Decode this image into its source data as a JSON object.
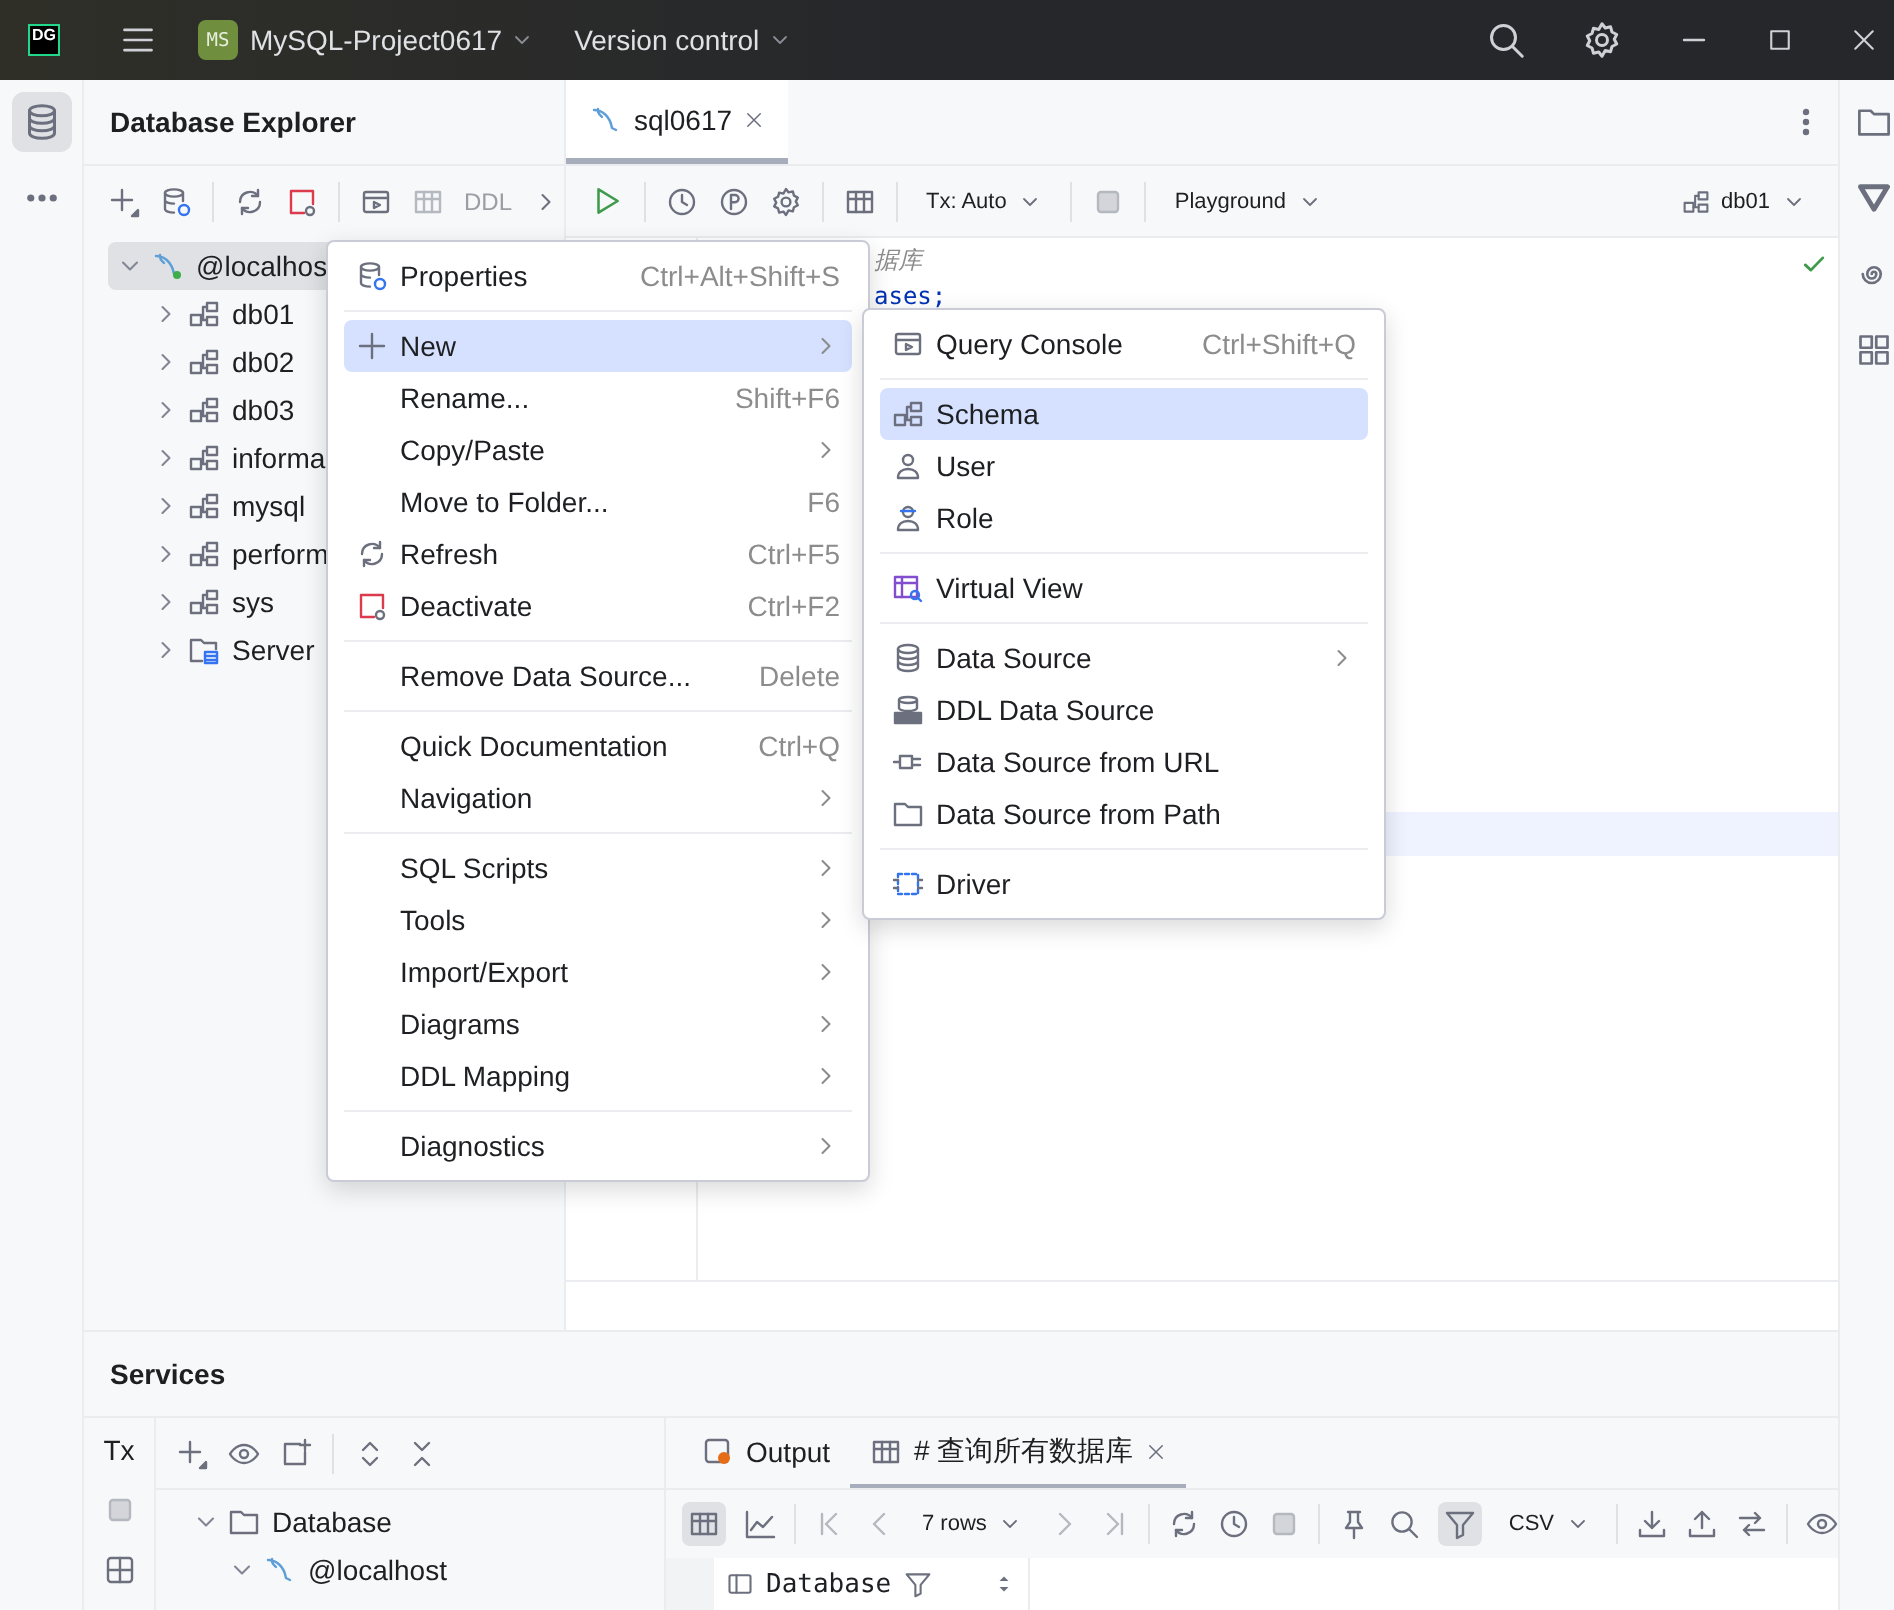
{
  "title_bar": {
    "logo": "DG",
    "project_initials": "MS",
    "project": "MySQL-Project0617",
    "vcs": "Version control"
  },
  "explorer": {
    "title": "Database Explorer",
    "toolbar_text": "DDL",
    "tree": [
      {
        "label": "@localhos",
        "kind": "datasource",
        "expanded": true,
        "selected": true,
        "children": [
          {
            "label": "db01",
            "kind": "schema",
            "expanded": false,
            "selected": false
          },
          {
            "label": "db02",
            "kind": "schema",
            "expanded": false,
            "selected": false
          },
          {
            "label": "db03",
            "kind": "schema",
            "expanded": false,
            "selected": false
          },
          {
            "label": "informa",
            "kind": "schema",
            "expanded": false,
            "selected": false
          },
          {
            "label": "mysql",
            "kind": "schema",
            "expanded": false,
            "selected": false
          },
          {
            "label": "perform",
            "kind": "schema",
            "expanded": false,
            "selected": false
          },
          {
            "label": "sys",
            "kind": "schema",
            "expanded": false,
            "selected": false
          },
          {
            "label": "Server",
            "kind": "folder",
            "expanded": false,
            "selected": false
          }
        ]
      }
    ]
  },
  "editor": {
    "tabs": [
      {
        "label": "sql0617",
        "selected": true
      }
    ],
    "tx": "Tx: Auto",
    "mode": "Playground",
    "schema": "db01",
    "lines": [
      {
        "kind": "comment",
        "text": "据库"
      },
      {
        "kind": "keyword",
        "text": "ases;"
      }
    ]
  },
  "context_menu": {
    "groups": [
      [
        {
          "label": "Properties",
          "shortcut": "Ctrl+Alt+Shift+S",
          "submenu": false,
          "selected": false
        }
      ],
      [
        {
          "label": "New",
          "submenu": true,
          "selected": true
        },
        {
          "label": "Rename...",
          "shortcut": "Shift+F6",
          "submenu": false,
          "selected": false
        },
        {
          "label": "Copy/Paste",
          "submenu": true,
          "selected": false
        },
        {
          "label": "Move to Folder...",
          "shortcut": "F6",
          "submenu": false,
          "selected": false
        },
        {
          "label": "Refresh",
          "shortcut": "Ctrl+F5",
          "submenu": false,
          "selected": false
        },
        {
          "label": "Deactivate",
          "shortcut": "Ctrl+F2",
          "submenu": false,
          "selected": false
        }
      ],
      [
        {
          "label": "Remove Data Source...",
          "shortcut": "Delete",
          "submenu": false,
          "selected": false
        }
      ],
      [
        {
          "label": "Quick Documentation",
          "shortcut": "Ctrl+Q",
          "submenu": false,
          "selected": false
        },
        {
          "label": "Navigation",
          "submenu": true,
          "selected": false
        }
      ],
      [
        {
          "label": "SQL Scripts",
          "submenu": true,
          "selected": false
        },
        {
          "label": "Tools",
          "submenu": true,
          "selected": false
        },
        {
          "label": "Import/Export",
          "submenu": true,
          "selected": false
        },
        {
          "label": "Diagrams",
          "submenu": true,
          "selected": false
        },
        {
          "label": "DDL Mapping",
          "submenu": true,
          "selected": false
        }
      ],
      [
        {
          "label": "Diagnostics",
          "submenu": true,
          "selected": false
        }
      ]
    ]
  },
  "new_submenu": {
    "groups": [
      [
        {
          "label": "Query Console",
          "shortcut": "Ctrl+Shift+Q",
          "submenu": false,
          "selected": false
        }
      ],
      [
        {
          "label": "Schema",
          "submenu": false,
          "selected": true
        },
        {
          "label": "User",
          "submenu": false,
          "selected": false
        },
        {
          "label": "Role",
          "submenu": false,
          "selected": false
        }
      ],
      [
        {
          "label": "Virtual View",
          "submenu": false,
          "selected": false
        }
      ],
      [
        {
          "label": "Data Source",
          "submenu": true,
          "selected": false
        },
        {
          "label": "DDL Data Source",
          "submenu": false,
          "selected": false
        },
        {
          "label": "Data Source from URL",
          "submenu": false,
          "selected": false
        },
        {
          "label": "Data Source from Path",
          "submenu": false,
          "selected": false
        }
      ],
      [
        {
          "label": "Driver",
          "submenu": false,
          "selected": false
        }
      ]
    ]
  },
  "services": {
    "title": "Services",
    "tx": "Tx",
    "tree": [
      {
        "label": "Database",
        "kind": "folder",
        "expanded": true,
        "children": [
          {
            "label": "@localhost",
            "kind": "datasource",
            "expanded": true
          }
        ]
      }
    ],
    "tabs": [
      {
        "label": "Output",
        "selected": false
      },
      {
        "label": "# 查询所有数据库",
        "selected": true
      }
    ],
    "rows": "7 rows",
    "format": "CSV",
    "columns": [
      {
        "label": "Database"
      }
    ]
  }
}
